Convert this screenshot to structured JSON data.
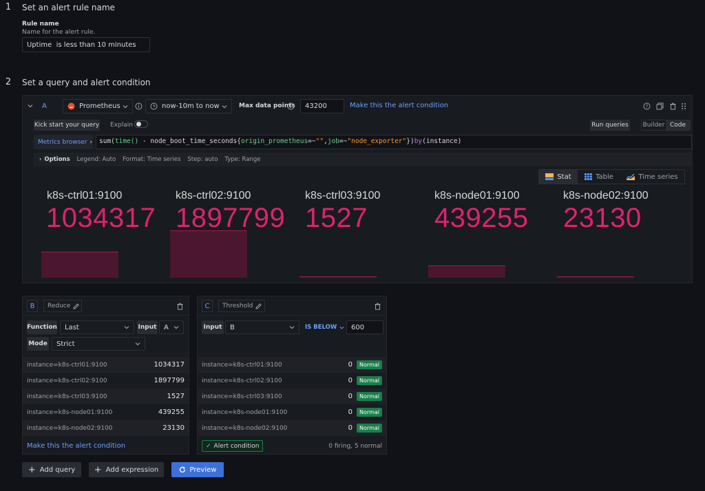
{
  "step1": {
    "num": "1",
    "title": "Set an alert rule name"
  },
  "rule_name": {
    "label": "Rule name",
    "description": "Name for the alert rule.",
    "value": "Uptime  is less than 10 minutes"
  },
  "step2": {
    "num": "2",
    "title": "Set a query and alert condition"
  },
  "query_a": {
    "ref": "A",
    "datasource": "Prometheus",
    "time_range": "now-10m to now",
    "max_points_label": "Max data points",
    "max_points_value": "43200",
    "make_condition": "Make this the alert condition",
    "kick_start": "Kick start your query",
    "explain": "Explain",
    "run_queries": "Run queries",
    "builder": "Builder",
    "code": "Code",
    "metrics_browser": "Metrics browser",
    "expr_p1": "sum(",
    "expr_p2": "time()",
    "expr_p3": " - node_boot_time_seconds{",
    "expr_p4": "origin_prometheus",
    "expr_p5": "=~",
    "expr_p6": "\"\"",
    "expr_p7": ",",
    "expr_p8": "job",
    "expr_p9": "=~",
    "expr_p10": "\"node_exporter\"",
    "expr_p11": "})",
    "expr_p12": "by",
    "expr_p13": "(instance)",
    "options_label": "Options",
    "options_legend": "Legend: Auto",
    "options_format": "Format: Time series",
    "options_step": "Step: auto",
    "options_type": "Type: Range",
    "view_stat": "Stat",
    "view_table": "Table",
    "view_timeseries": "Time series",
    "stats": [
      {
        "label": "k8s-ctrl01:9100",
        "value": "1034317"
      },
      {
        "label": "k8s-ctrl02:9100",
        "value": "1897799"
      },
      {
        "label": "k8s-ctrl03:9100",
        "value": "1527"
      },
      {
        "label": "k8s-node01:9100",
        "value": "439255"
      },
      {
        "label": "k8s-node02:9100",
        "value": "23130"
      }
    ]
  },
  "reduce": {
    "ref": "B",
    "name": "Reduce",
    "function_label": "Function",
    "function_value": "Last",
    "input_label": "Input",
    "input_value": "A",
    "mode_label": "Mode",
    "mode_value": "Strict",
    "rows": [
      {
        "key": "instance=k8s-ctrl01:9100",
        "val": "1034317"
      },
      {
        "key": "instance=k8s-ctrl02:9100",
        "val": "1897799"
      },
      {
        "key": "instance=k8s-ctrl03:9100",
        "val": "1527"
      },
      {
        "key": "instance=k8s-node01:9100",
        "val": "439255"
      },
      {
        "key": "instance=k8s-node02:9100",
        "val": "23130"
      }
    ],
    "make_condition": "Make this the alert condition"
  },
  "threshold": {
    "ref": "C",
    "name": "Threshold",
    "input_label": "Input",
    "input_value": "B",
    "op": "IS BELOW",
    "op_value": "600",
    "rows": [
      {
        "key": "instance=k8s-ctrl01:9100",
        "val": "0",
        "status": "Normal"
      },
      {
        "key": "instance=k8s-ctrl02:9100",
        "val": "0",
        "status": "Normal"
      },
      {
        "key": "instance=k8s-ctrl03:9100",
        "val": "0",
        "status": "Normal"
      },
      {
        "key": "instance=k8s-node01:9100",
        "val": "0",
        "status": "Normal"
      },
      {
        "key": "instance=k8s-node02:9100",
        "val": "0",
        "status": "Normal"
      }
    ],
    "alert_condition": "Alert condition",
    "summary": "0 firing, 5 normal"
  },
  "footer": {
    "add_query": "Add query",
    "add_expression": "Add expression",
    "preview": "Preview"
  },
  "colors": {
    "stat_value": "#e0226e",
    "accent_blue": "#3d71d9",
    "normal_green": "#1a7f4b"
  }
}
